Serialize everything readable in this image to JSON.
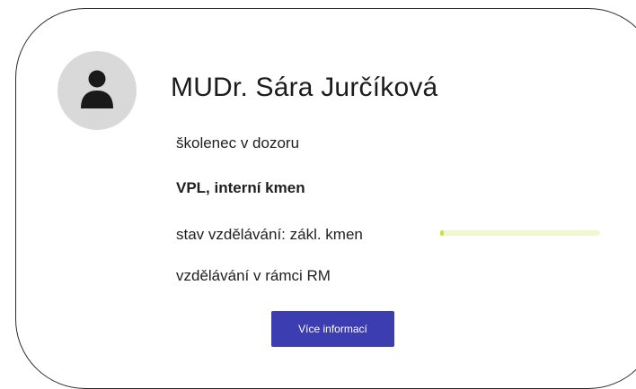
{
  "profile": {
    "name": "MUDr. Sára Jurčíková",
    "role": "školenec v dozoru",
    "department": "VPL, interní kmen",
    "status_label": "stav vzdělávání: zákl. kmen",
    "status_progress": 0.01,
    "rm_label": "vzdělávání v rámci RM",
    "avatar_icon": "user-icon"
  },
  "actions": {
    "more_info_label": "Více informací"
  },
  "colors": {
    "button": "#3c3db0",
    "progress_track": "#eef8cf",
    "progress_fill": "#c8e04a",
    "avatar_bg": "#d9d9d9"
  }
}
